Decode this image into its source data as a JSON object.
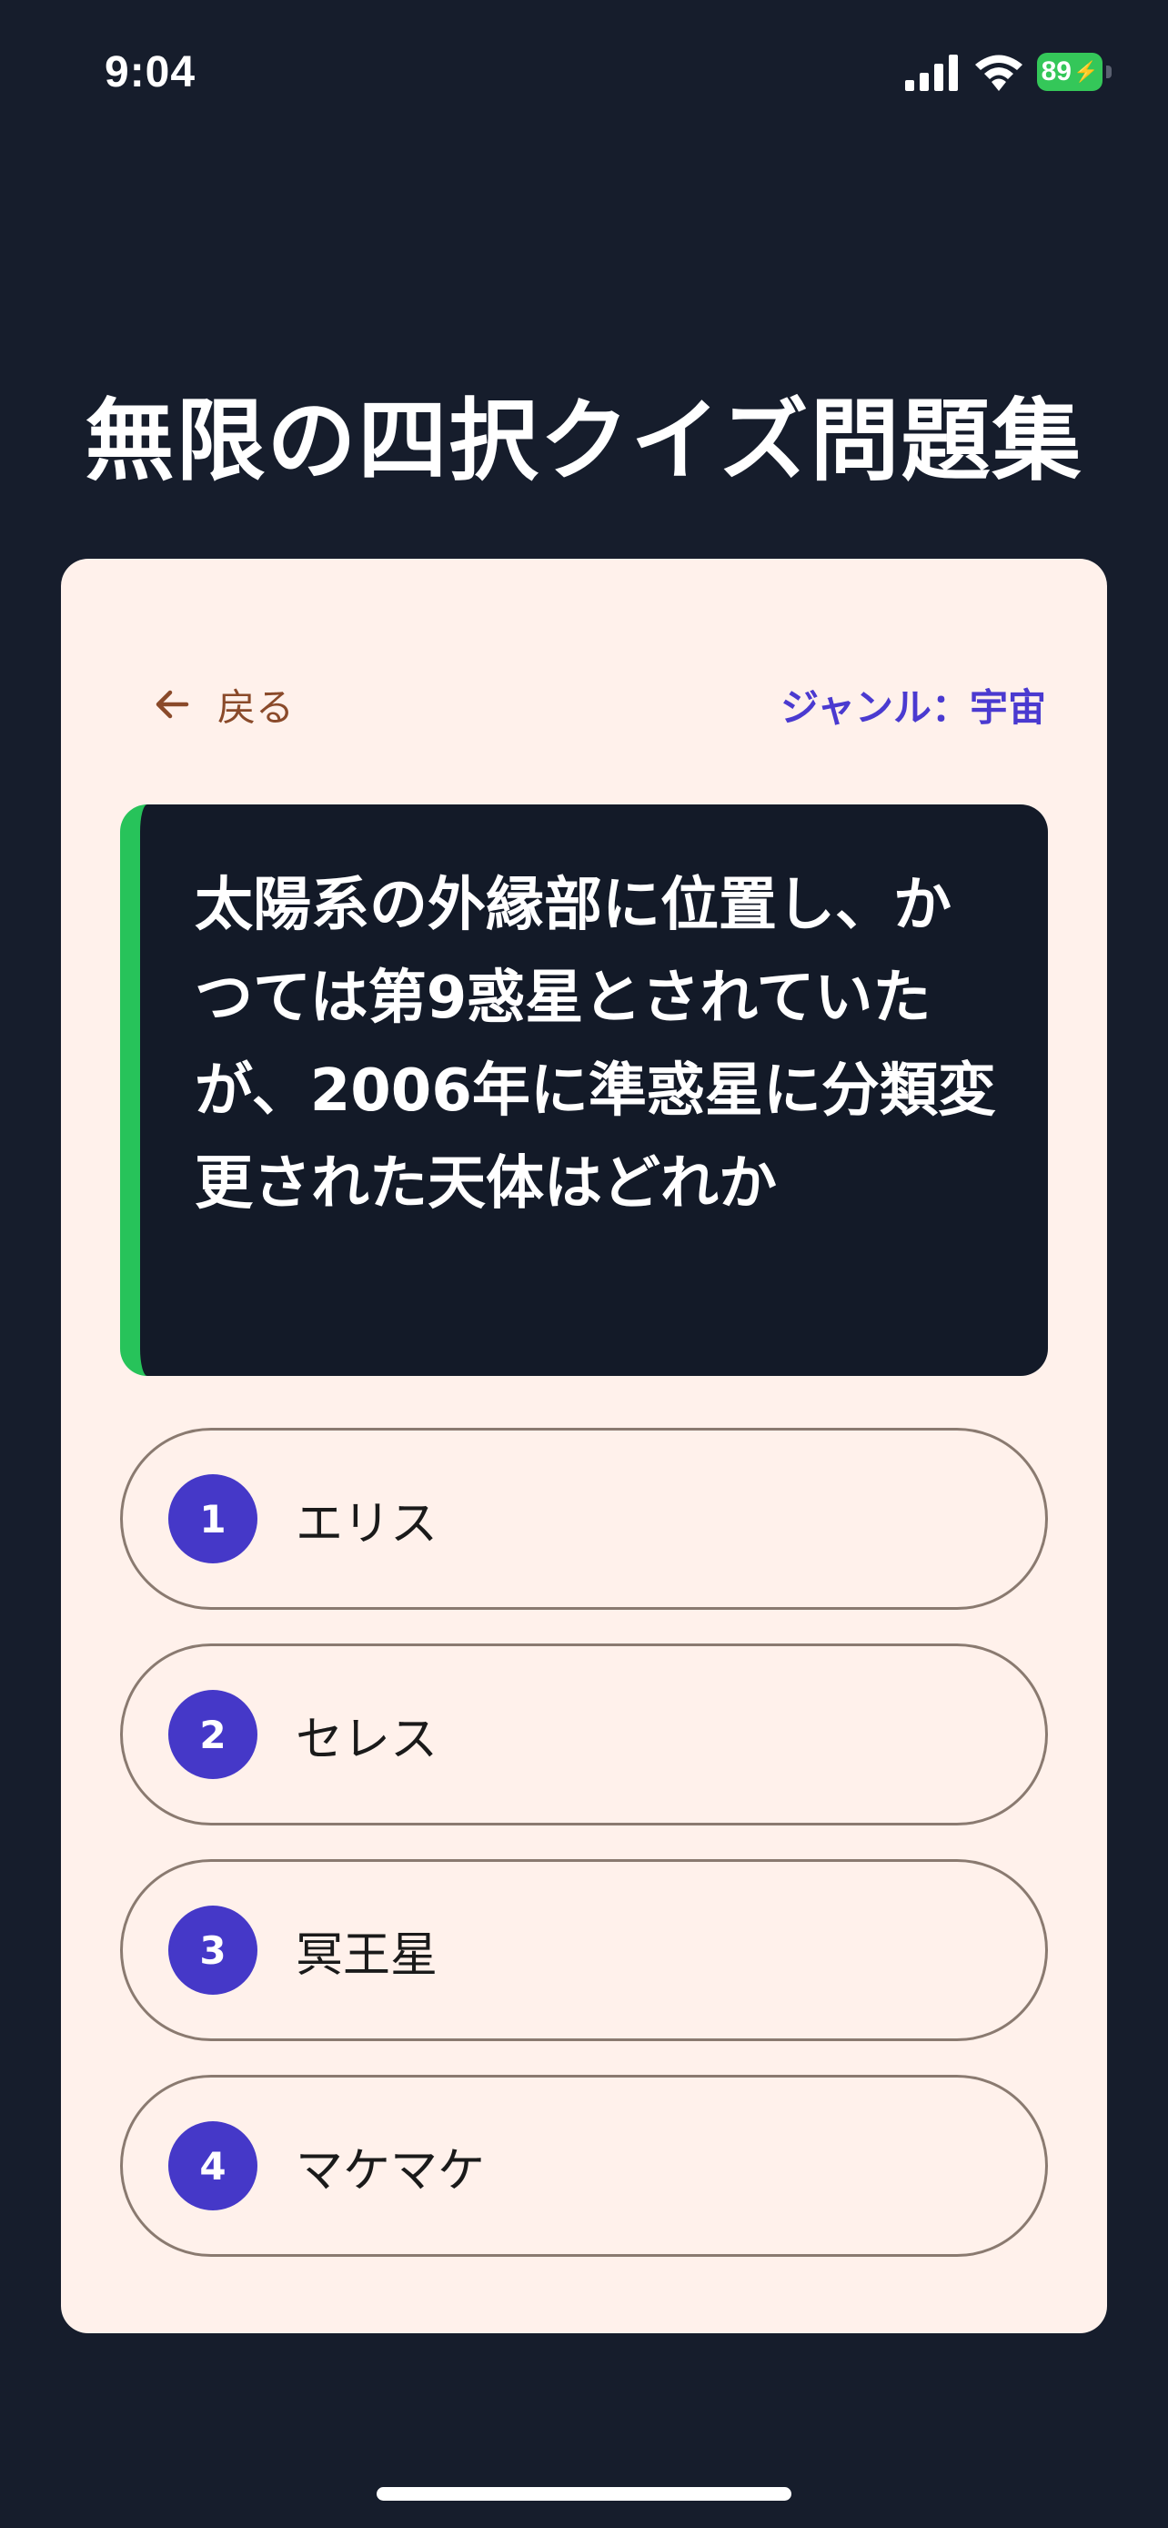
{
  "status_bar": {
    "time": "9:04",
    "battery_level": "89",
    "icons": [
      "signal-icon",
      "wifi-icon",
      "battery-charging-icon"
    ]
  },
  "app": {
    "title": "無限の四択クイズ問題集"
  },
  "card": {
    "back_label": "戻る",
    "genre_label": "ジャンル：宇宙",
    "question": "太陽系の外縁部に位置し、かつては第9惑星とされていたが、2006年に準惑星に分類変更された天体はどれか",
    "options": [
      {
        "number": "1",
        "label": "エリス"
      },
      {
        "number": "2",
        "label": "セレス"
      },
      {
        "number": "3",
        "label": "冥王星"
      },
      {
        "number": "4",
        "label": "マケマケ"
      }
    ]
  },
  "colors": {
    "background": "#161d2c",
    "card": "#fff1eb",
    "question_bg": "#131a28",
    "accent_green": "#27c35a",
    "option_number": "#4538c8",
    "genre": "#4a3ad0",
    "back": "#8a4a2a"
  }
}
